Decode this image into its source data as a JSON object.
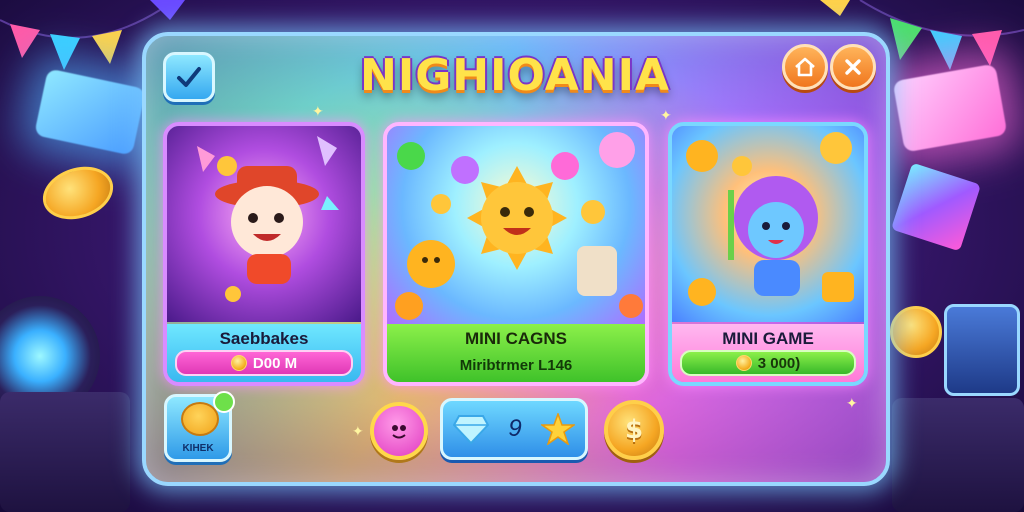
{
  "title": "NIGHIOANIA",
  "top_buttons": {
    "confirm_icon": "checkmark-icon",
    "home_icon": "home-icon",
    "close_icon": "close-icon"
  },
  "cards": [
    {
      "title": "Saebbakes",
      "value": "D00 M",
      "icon": "coin-icon"
    },
    {
      "title": "MINI CAGNS",
      "subtitle": "Miribtrmer L146"
    },
    {
      "title": "MINI GAME",
      "value": "3 000)",
      "icon": "coin-icon"
    }
  ],
  "bottom_bar": {
    "avatar_label": "KIHEK",
    "gem_count": "9",
    "gem_icon": "diamond-icon",
    "star_icon": "star-icon",
    "dollar_symbol": "$"
  },
  "colors": {
    "title_fill": "#ffe34a",
    "card1_label": "#39b8f0",
    "card2_label": "#3fc22a",
    "card3_label": "#ff7ad8"
  }
}
